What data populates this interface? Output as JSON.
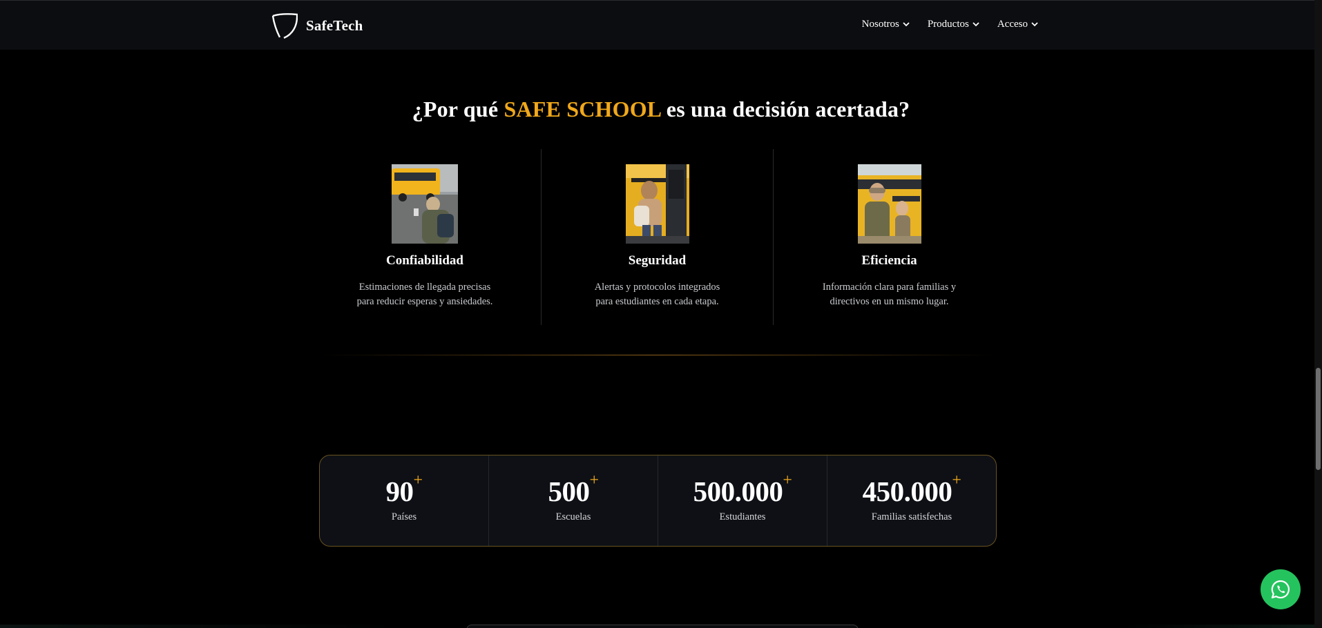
{
  "header": {
    "brand": "SafeTech",
    "logo_icon": "shield-logo",
    "nav": [
      {
        "label": "Nosotros",
        "icon": "chevron-down-icon"
      },
      {
        "label": "Productos",
        "icon": "chevron-down-icon"
      },
      {
        "label": "Acceso",
        "icon": "chevron-down-icon"
      }
    ]
  },
  "why": {
    "title_before": "¿Por qué ",
    "title_accent": "SAFE SCHOOL",
    "title_after": " es una decisión acertada?",
    "features": [
      {
        "title": "Confiabilidad",
        "line1": "Estimaciones de llegada precisas",
        "line2": "para reducir esperas y ansiedades."
      },
      {
        "title": "Seguridad",
        "line1": "Alertas y protocolos integrados",
        "line2": "para estudiantes en cada etapa."
      },
      {
        "title": "Eficiencia",
        "line1": "Información clara para familias y",
        "line2": "directivos en un mismo lugar."
      }
    ]
  },
  "stats": [
    {
      "value": "90",
      "plus": "+",
      "label": "Países"
    },
    {
      "value": "500",
      "plus": "+",
      "label": "Escuelas"
    },
    {
      "value": "500.000",
      "plus": "+",
      "label": "Estudiantes"
    },
    {
      "value": "450.000",
      "plus": "+",
      "label": "Familias satisfechas"
    }
  ],
  "colors": {
    "accent": "#f0a81b",
    "background": "#000000",
    "whatsapp": "#25c35e"
  },
  "floating": {
    "icon": "whatsapp-icon"
  }
}
